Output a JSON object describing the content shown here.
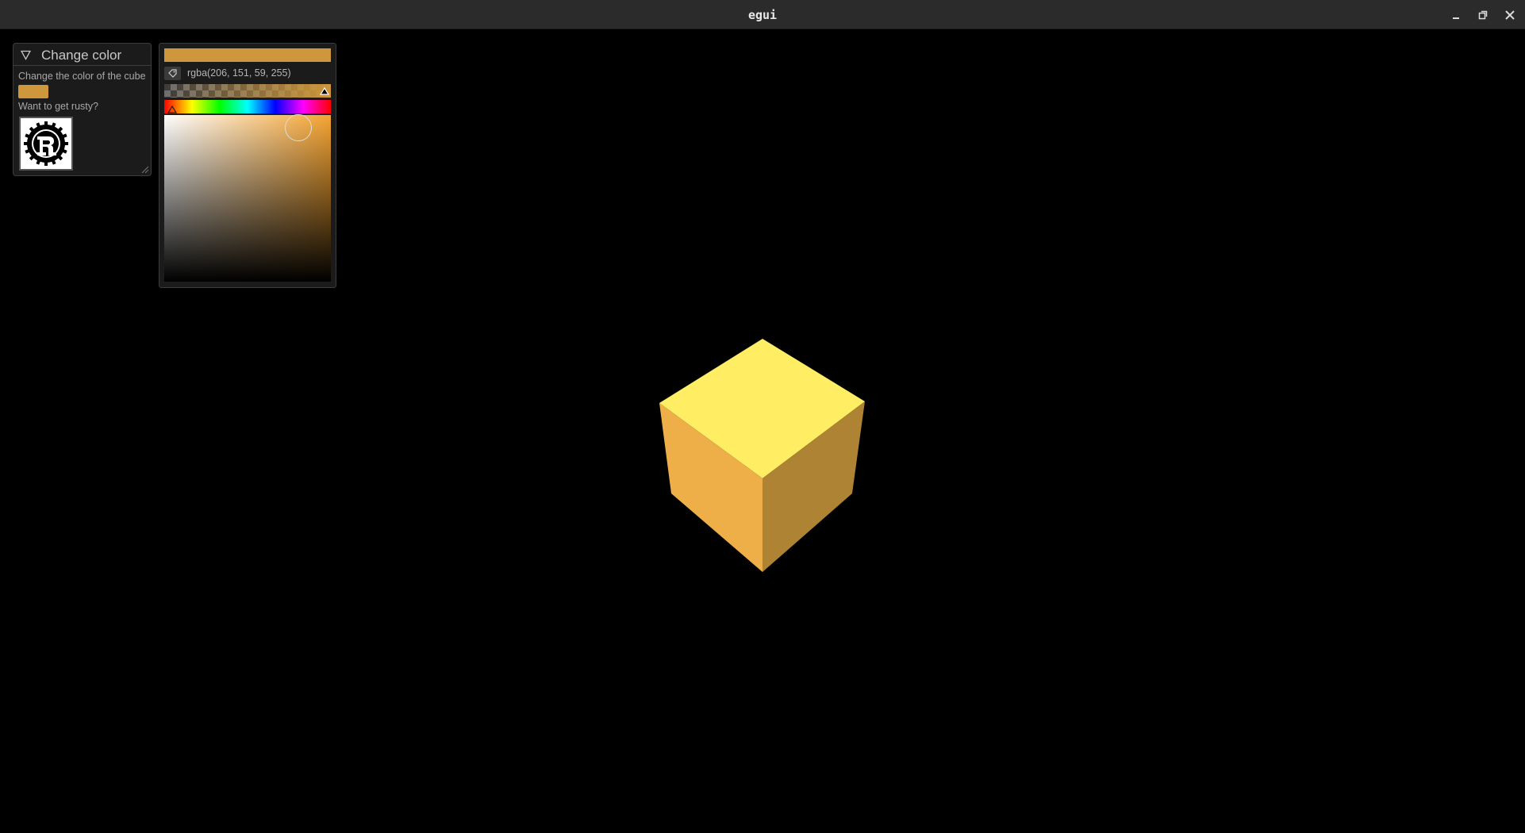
{
  "app": {
    "title": "egui"
  },
  "window_controls": {
    "minimize_icon": "minimize-icon",
    "maximize_icon": "restore-icon",
    "close_icon": "close-icon"
  },
  "change_color_window": {
    "title": "Change color",
    "description": "Change the color of the cube",
    "swatch_color": "#ce973b",
    "rust_prompt": "Want to get rusty?",
    "rust_image_icon": "rust-logo-icon"
  },
  "color_picker": {
    "value_text": "rgba(206, 151, 59, 255)",
    "color": "#ce973b",
    "alpha": 1.0,
    "hue_fraction": 0.1,
    "copy_icon": "copy-icon"
  },
  "scene": {
    "cube_top": "#ffed63",
    "cube_left": "#eeae48",
    "cube_right": "#ae8334"
  }
}
